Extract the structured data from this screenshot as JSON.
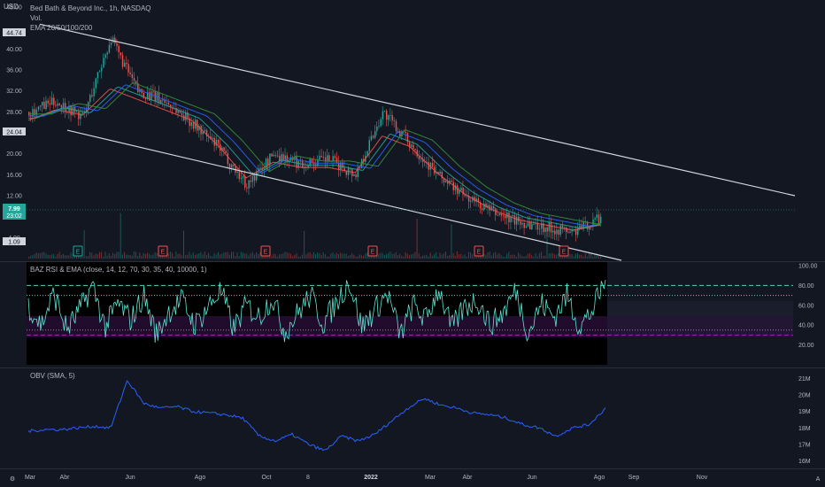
{
  "price_pane": {
    "currency": "USD",
    "legend": [
      "Bed Bath & Beyond Inc., 1h, NASDAQ",
      "Vol.",
      "EMA 20/50/100/200"
    ],
    "badges": {
      "top": "44.74",
      "mid": "24.04",
      "last": "7.99",
      "countdown": "23:02",
      "low": "1.09"
    },
    "earnings_marker": "E"
  },
  "rsi_pane": {
    "legend": "BAZ RSI & EMA (close, 14, 12, 70, 30, 35, 40, 10000, 1)"
  },
  "obv_pane": {
    "legend": "OBV (SMA, 5)"
  },
  "time_axis": {
    "labels": [
      "Mar",
      "Abr",
      "Jun",
      "Ago",
      "Oct",
      "8",
      "2022",
      "Mar",
      "Abr",
      "Jun",
      "Ago",
      "Sep",
      "Nov"
    ]
  },
  "colors": {
    "background": "#131722",
    "candle_up": "#26a69a",
    "candle_down": "#ef5350",
    "rsi_line": "#5ee6d0",
    "upper_band": "#4fd1c5",
    "lower_band": "#9c27b0",
    "obv_line": "#2962ff",
    "channel": "#d1d4dc"
  },
  "chart_data": [
    {
      "type": "line",
      "name": "price",
      "title": "Bed Bath & Beyond Inc., 1h, NASDAQ",
      "ylabel": "USD",
      "y_ticks": [
        48,
        40,
        36,
        32,
        28,
        20,
        16,
        12,
        8,
        4
      ],
      "ylim": [
        0,
        48
      ],
      "x": [
        "Mar",
        "Abr",
        "Jun",
        "Ago",
        "Oct",
        "8",
        "2022",
        "Mar",
        "Abr",
        "Jun",
        "Ago"
      ],
      "series": [
        {
          "name": "close",
          "values": [
            28,
            30,
            27,
            42,
            32,
            30,
            26,
            21,
            14,
            20,
            18,
            19,
            16,
            28,
            22,
            16,
            12,
            9,
            7,
            6,
            5,
            8
          ]
        },
        {
          "name": "EMA 20/50/100/200",
          "values": [
            27,
            29,
            28,
            33,
            31,
            29,
            27,
            22,
            16,
            19,
            18,
            18,
            17,
            24,
            22,
            17,
            13,
            10,
            8,
            7,
            6,
            7
          ]
        }
      ],
      "channel": {
        "upper": [
          [
            45,
            44.74
          ],
          [
            898,
            12
          ]
        ],
        "lower": [
          [
            76,
            24.5
          ],
          [
            702,
            0
          ]
        ]
      },
      "last": 7.99
    },
    {
      "type": "line",
      "name": "rsi",
      "y_ticks": [
        100,
        80,
        60,
        40,
        20
      ],
      "ylim": [
        0,
        100
      ],
      "bands": [
        80,
        70,
        35,
        30
      ],
      "values": [
        60,
        40,
        72,
        35,
        55,
        80,
        38,
        62,
        45,
        70,
        30,
        55,
        65,
        40,
        58,
        75,
        36,
        60,
        48,
        68,
        33,
        52,
        70,
        42,
        62,
        85,
        38,
        55,
        72,
        30,
        60,
        45,
        78,
        36,
        58,
        66,
        40,
        52,
        75,
        32,
        62,
        48,
        70,
        38,
        55,
        85
      ]
    },
    {
      "type": "line",
      "name": "obv",
      "y_ticks": [
        "21M",
        "20M",
        "19M",
        "18M",
        "17M",
        "16M"
      ],
      "ylim": [
        15.8,
        21.2
      ],
      "values": [
        17.8,
        17.9,
        17.9,
        18.0,
        18.1,
        18.0,
        20.9,
        19.5,
        19.2,
        19.3,
        19.0,
        18.9,
        18.8,
        18.6,
        17.5,
        17.2,
        17.6,
        17.0,
        16.6,
        17.5,
        17.2,
        17.6,
        18.4,
        19.2,
        19.8,
        19.4,
        19.2,
        18.9,
        18.8,
        18.6,
        18.2,
        18.0,
        17.5,
        18.0,
        18.2,
        19.2
      ]
    }
  ]
}
